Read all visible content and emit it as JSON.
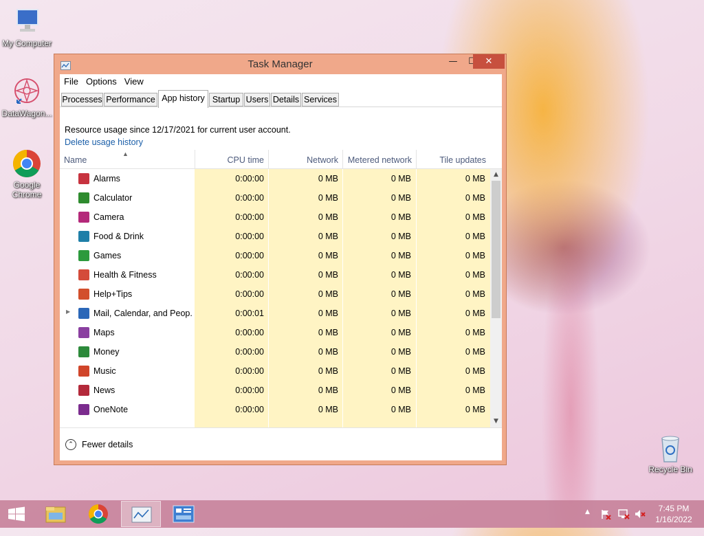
{
  "desktop": {
    "icons": [
      {
        "label": "My Computer"
      },
      {
        "label": "DataWagon..."
      },
      {
        "label": "Google Chrome"
      },
      {
        "label": "Recycle Bin"
      }
    ]
  },
  "window": {
    "title": "Task Manager",
    "buttons": {
      "minimize": "—",
      "maximize": "☐",
      "close": "✕"
    },
    "menu": [
      "File",
      "Options",
      "View"
    ],
    "tabs": [
      "Processes",
      "Performance",
      "App history",
      "Startup",
      "Users",
      "Details",
      "Services"
    ],
    "active_tab": "App history",
    "info_text": "Resource usage since 12/17/2021 for current user account.",
    "delete_link": "Delete usage history",
    "columns": [
      "Name",
      "CPU time",
      "Network",
      "Metered network",
      "Tile updates"
    ],
    "rows": [
      {
        "name": "Alarms",
        "cpu": "0:00:00",
        "net": "0 MB",
        "metered": "0 MB",
        "tile": "0 MB",
        "color": "#c7333f"
      },
      {
        "name": "Calculator",
        "cpu": "0:00:00",
        "net": "0 MB",
        "metered": "0 MB",
        "tile": "0 MB",
        "color": "#2e8b2e"
      },
      {
        "name": "Camera",
        "cpu": "0:00:00",
        "net": "0 MB",
        "metered": "0 MB",
        "tile": "0 MB",
        "color": "#b4297a"
      },
      {
        "name": "Food & Drink",
        "cpu": "0:00:00",
        "net": "0 MB",
        "metered": "0 MB",
        "tile": "0 MB",
        "color": "#1f7fa8"
      },
      {
        "name": "Games",
        "cpu": "0:00:00",
        "net": "0 MB",
        "metered": "0 MB",
        "tile": "0 MB",
        "color": "#2c9a3c"
      },
      {
        "name": "Health & Fitness",
        "cpu": "0:00:00",
        "net": "0 MB",
        "metered": "0 MB",
        "tile": "0 MB",
        "color": "#d44b3a"
      },
      {
        "name": "Help+Tips",
        "cpu": "0:00:00",
        "net": "0 MB",
        "metered": "0 MB",
        "tile": "0 MB",
        "color": "#d24f2c"
      },
      {
        "name": "Mail, Calendar, and Peop...",
        "cpu": "0:00:01",
        "net": "0 MB",
        "metered": "0 MB",
        "tile": "0 MB",
        "color": "#2b67b8",
        "expandable": true
      },
      {
        "name": "Maps",
        "cpu": "0:00:00",
        "net": "0 MB",
        "metered": "0 MB",
        "tile": "0 MB",
        "color": "#8a3fa0"
      },
      {
        "name": "Money",
        "cpu": "0:00:00",
        "net": "0 MB",
        "metered": "0 MB",
        "tile": "0 MB",
        "color": "#2d8a3b"
      },
      {
        "name": "Music",
        "cpu": "0:00:00",
        "net": "0 MB",
        "metered": "0 MB",
        "tile": "0 MB",
        "color": "#d0452a"
      },
      {
        "name": "News",
        "cpu": "0:00:00",
        "net": "0 MB",
        "metered": "0 MB",
        "tile": "0 MB",
        "color": "#b3293a"
      },
      {
        "name": "OneNote",
        "cpu": "0:00:00",
        "net": "0 MB",
        "metered": "0 MB",
        "tile": "0 MB",
        "color": "#7b2c8e"
      }
    ],
    "fewer_details": "Fewer details"
  },
  "taskbar": {
    "time": "7:45 PM",
    "date": "1/16/2022"
  }
}
